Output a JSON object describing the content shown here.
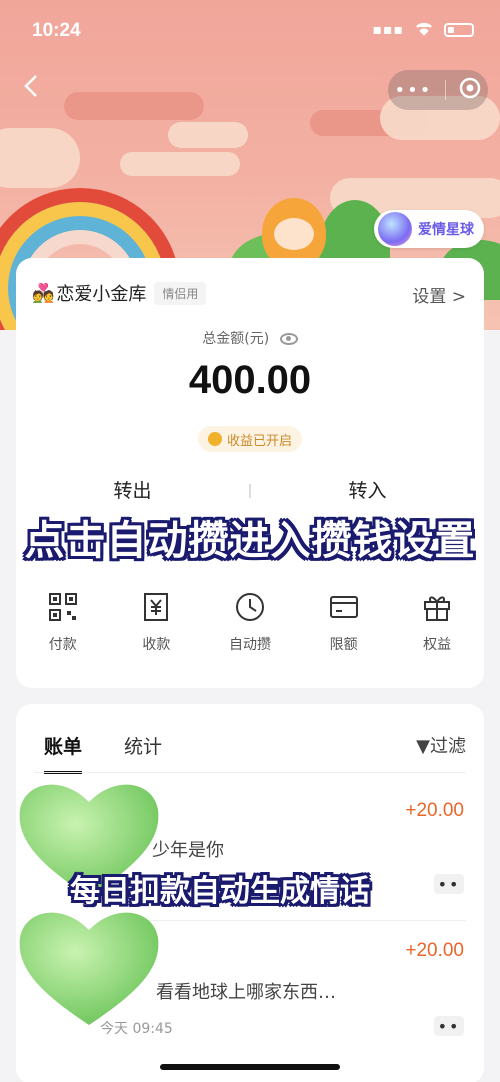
{
  "status_bar": {
    "time": "10:24"
  },
  "header": {
    "planet_label": "爱情星球"
  },
  "account": {
    "emoji": "💑",
    "name": "恋爱小金库",
    "tag": "情侣用",
    "settings_label": "设置 >",
    "total_label": "总金额(元)",
    "total": "400.00",
    "income_label": "收益已开启",
    "transfer_out": "转出",
    "transfer_in": "转入"
  },
  "banner_top": "点击自动攒进入攒钱设置",
  "tools": [
    {
      "label": "付款",
      "icon": "qr-code-icon"
    },
    {
      "label": "收款",
      "icon": "yen-receipt-icon"
    },
    {
      "label": "自动攒",
      "icon": "clock-icon"
    },
    {
      "label": "限额",
      "icon": "card-icon"
    },
    {
      "label": "权益",
      "icon": "gift-icon"
    }
  ],
  "bill": {
    "tabs": [
      "账单",
      "统计"
    ],
    "filter_label": "过滤",
    "rows": [
      {
        "amount": "+20.00",
        "text": "少年是你",
        "more": "••"
      },
      {
        "amount": "+20.00",
        "text": "看看地球上哪家东西…",
        "time": "今天 09:45",
        "more": "••"
      }
    ]
  },
  "banner_bottom": "每日扣款自动生成情话",
  "colors": {
    "accent_orange": "#e8662a",
    "banner_outline": "#1a1a6e",
    "heart_green": "#7fd36a"
  }
}
